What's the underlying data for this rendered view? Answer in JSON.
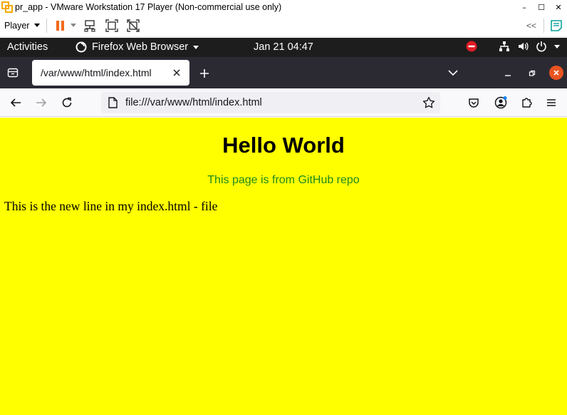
{
  "vmware": {
    "title": "pr_app - VMware Workstation 17 Player (Non-commercial use only)",
    "player_menu": "Player",
    "window_buttons": [
      "–",
      "☐",
      "✕"
    ],
    "collapse_label": "<<"
  },
  "gnome": {
    "activities": "Activities",
    "app_name": "Firefox Web Browser",
    "clock": "Jan 21  04:47"
  },
  "firefox": {
    "tab_title": "/var/www/html/index.html",
    "url": "file:///var/www/html/index.html",
    "new_tab_glyph": "+"
  },
  "page": {
    "heading": "Hello World",
    "subheading": "This page is from GitHub repo",
    "paragraph": "This is the new line in my index.html - file",
    "background": "#ffff00",
    "subheading_color": "#1f8a1f"
  }
}
